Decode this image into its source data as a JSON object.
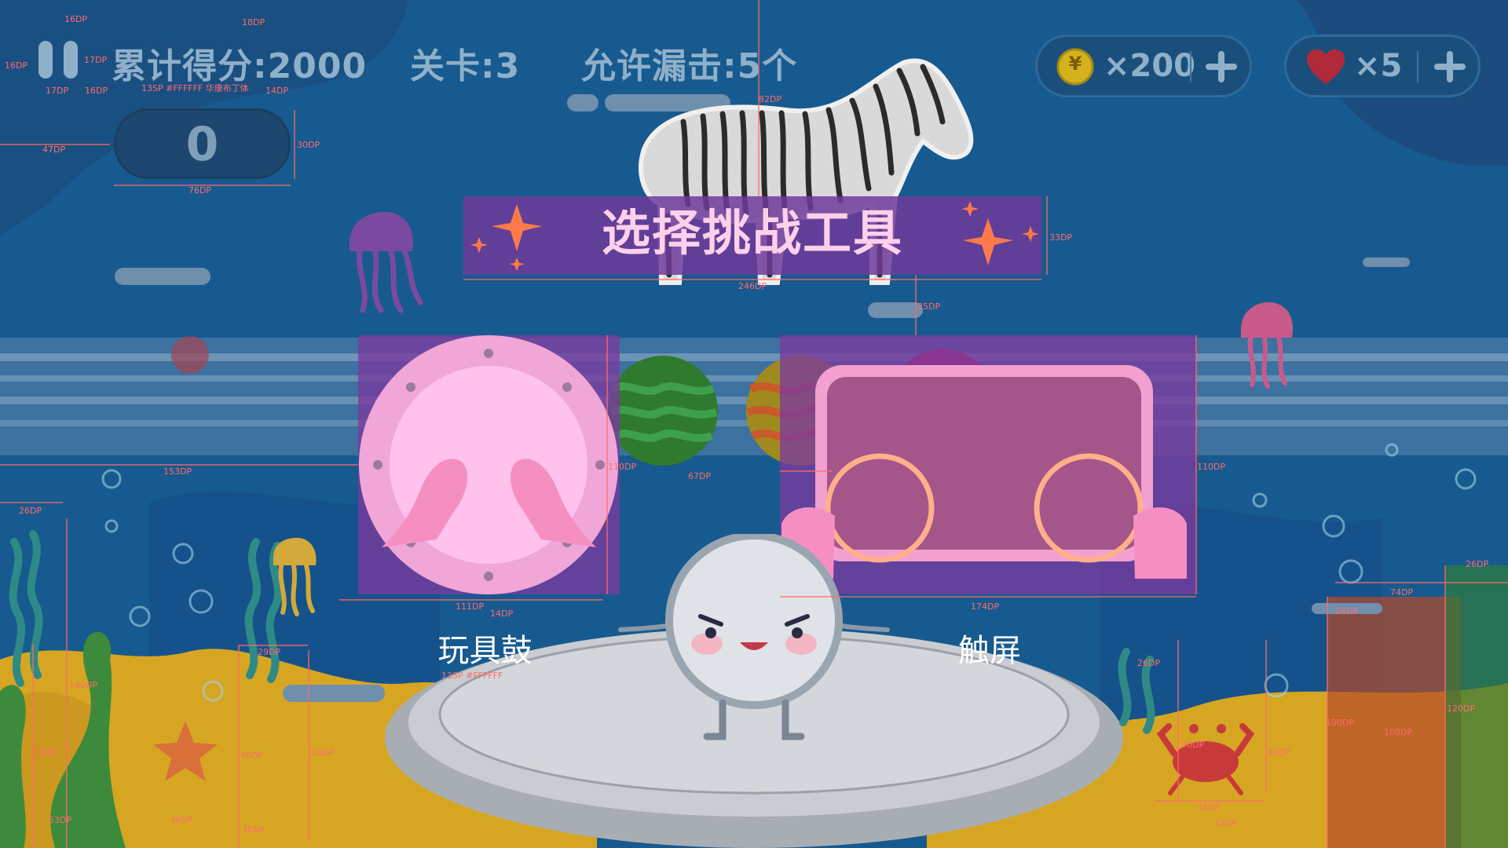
{
  "hud": {
    "score_label": "累计得分:2000",
    "level_label": "关卡:3",
    "miss_label": "允许漏击:5个",
    "current_score": "0",
    "coins": "×200",
    "lives": "×5",
    "coin_symbol": "¥"
  },
  "panel": {
    "title": "选择挑战工具",
    "options": [
      {
        "label": "玩具鼓"
      },
      {
        "label": "触屏"
      }
    ]
  },
  "annotations": {
    "a1": "16DP",
    "a2": "18DP",
    "a3": "16DP",
    "a4": "17DP",
    "a5": "17DP",
    "a6": "16DP",
    "a7": "13SP #FFFFFF 华康布丁体",
    "a8": "14DP",
    "a9": "47DP",
    "a10": "30DP",
    "a11": "76DP",
    "a12": "82DP",
    "a13": "33DP",
    "a14": "246DP",
    "a15": "25DP",
    "a16": "153DP",
    "a17": "110DP",
    "a18": "67DP",
    "a19": "110DP",
    "a20": "111DP",
    "a21": "14DP",
    "a22": "174DP",
    "a23": "13SP #FFFFFF",
    "a24": "26DP",
    "a25": "29DP",
    "a26": "140DP",
    "a27": "83DP",
    "a28": "46DP",
    "a29": "83DP",
    "a30": "53DP",
    "a31": "46DP",
    "a32": "16DP",
    "a33": "26DP",
    "a34": "90DP",
    "a35": "40DP",
    "a36": "45DP",
    "a37": "22DP",
    "a38": "26DP",
    "a39": "74DP",
    "a40": "26DP",
    "a41": "100DP",
    "a42": "100DP",
    "a43": "120DP"
  },
  "colors": {
    "background": "#175a8f",
    "purple_overlay": "#7a3a9e",
    "title_text": "#ffd0ea",
    "hud_text": "#8fb0c9",
    "measure_line": "#ff6b6b"
  },
  "icons": [
    "pause-icon",
    "coin-icon",
    "heart-icon",
    "plus-icon",
    "drum-icon",
    "touchscreen-icon",
    "zebra-illustration",
    "mascot-character",
    "jellyfish-icon",
    "crab-icon",
    "starfish-icon",
    "seaweed-icon"
  ]
}
